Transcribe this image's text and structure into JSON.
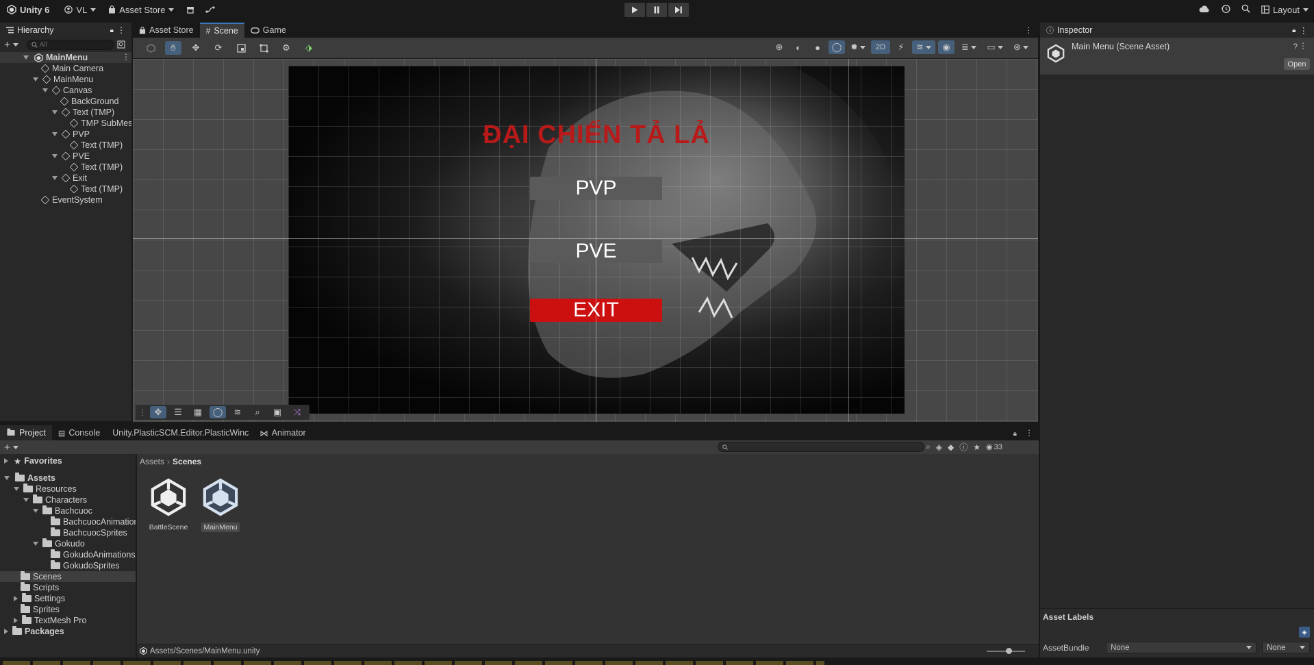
{
  "topbar": {
    "app_title": "Unity 6",
    "account": "VL",
    "asset_store": "Asset Store",
    "layout": "Layout"
  },
  "hierarchy": {
    "tab_label": "Hierarchy",
    "search_placeholder": "All",
    "items": [
      {
        "label": "MainMenu"
      },
      {
        "label": "Main Camera"
      },
      {
        "label": "MainMenu"
      },
      {
        "label": "Canvas"
      },
      {
        "label": "BackGround"
      },
      {
        "label": "Text (TMP)"
      },
      {
        "label": "TMP SubMes"
      },
      {
        "label": "PVP"
      },
      {
        "label": "Text (TMP)"
      },
      {
        "label": "PVE"
      },
      {
        "label": "Text (TMP)"
      },
      {
        "label": "Exit"
      },
      {
        "label": "Text (TMP)"
      },
      {
        "label": "EventSystem"
      }
    ]
  },
  "center_tabs": {
    "asset_store": "Asset Store",
    "scene": "Scene",
    "game": "Game"
  },
  "scene_toolbar": {
    "mode_2d": "2D"
  },
  "game_menu": {
    "title": "ĐẠI CHIẾN TẢ LẢ",
    "pvp": "PVP",
    "pve": "PVE",
    "exit": "EXIT"
  },
  "inspector": {
    "tab_label": "Inspector",
    "asset_name": "Main Menu (Scene Asset)",
    "open_button": "Open",
    "asset_labels": "Asset Labels",
    "asset_bundle_label": "AssetBundle",
    "asset_bundle_value": "None",
    "asset_variant_value": "None"
  },
  "bottom_tabs": {
    "project": "Project",
    "console": "Console",
    "plastic": "Unity.PlasticSCM.Editor.PlasticWinc",
    "animator": "Animator"
  },
  "project": {
    "hidden_count": "33",
    "breadcrumb_root": "Assets",
    "breadcrumb_current": "Scenes",
    "favorites": "Favorites",
    "tree": [
      {
        "label": "Assets"
      },
      {
        "label": "Resources"
      },
      {
        "label": "Characters"
      },
      {
        "label": "Bachcuoc"
      },
      {
        "label": "BachcuocAnimation"
      },
      {
        "label": "BachcuocSprites"
      },
      {
        "label": "Gokudo"
      },
      {
        "label": "GokudoAnimations"
      },
      {
        "label": "GokudoSprites"
      },
      {
        "label": "Scenes"
      },
      {
        "label": "Scripts"
      },
      {
        "label": "Settings"
      },
      {
        "label": "Sprites"
      },
      {
        "label": "TextMesh Pro"
      },
      {
        "label": "Packages"
      }
    ],
    "assets": [
      {
        "label": "BattleScene"
      },
      {
        "label": "MainMenu"
      }
    ],
    "status_path": "Assets/Scenes/MainMenu.unity"
  },
  "colors": {
    "accent": "#3a79bb",
    "title_red": "#b81a1a",
    "exit_red": "#cc0f0f"
  }
}
